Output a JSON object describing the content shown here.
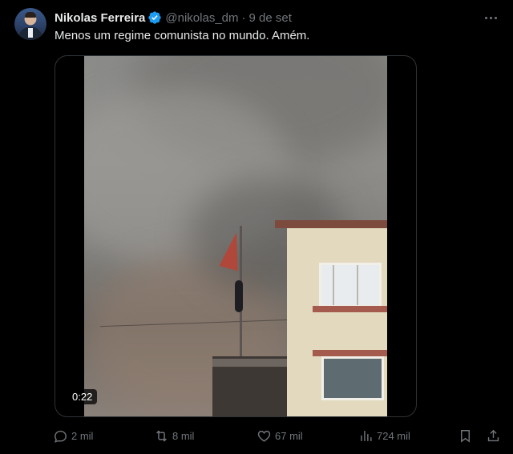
{
  "author": {
    "name": "Nikolas Ferreira",
    "handle": "@nikolas_dm",
    "separator": "·",
    "date": "9 de set"
  },
  "tweet": {
    "text": "Menos um regime comunista no mundo. Amém."
  },
  "media": {
    "timer": "0:22"
  },
  "actions": {
    "replies": "2 mil",
    "retweets": "8 mil",
    "likes": "67 mil",
    "views": "724 mil"
  },
  "icons": {
    "verified": "verified-badge-icon",
    "more": "more-dots-icon",
    "reply": "reply-icon",
    "retweet": "retweet-icon",
    "like": "heart-icon",
    "views": "views-chart-icon",
    "bookmark": "bookmark-icon",
    "share": "share-icon"
  },
  "colors": {
    "background": "#000000",
    "text": "#e7e9ea",
    "muted": "#71767b",
    "verified": "#1d9bf0",
    "border": "#2f3336"
  }
}
